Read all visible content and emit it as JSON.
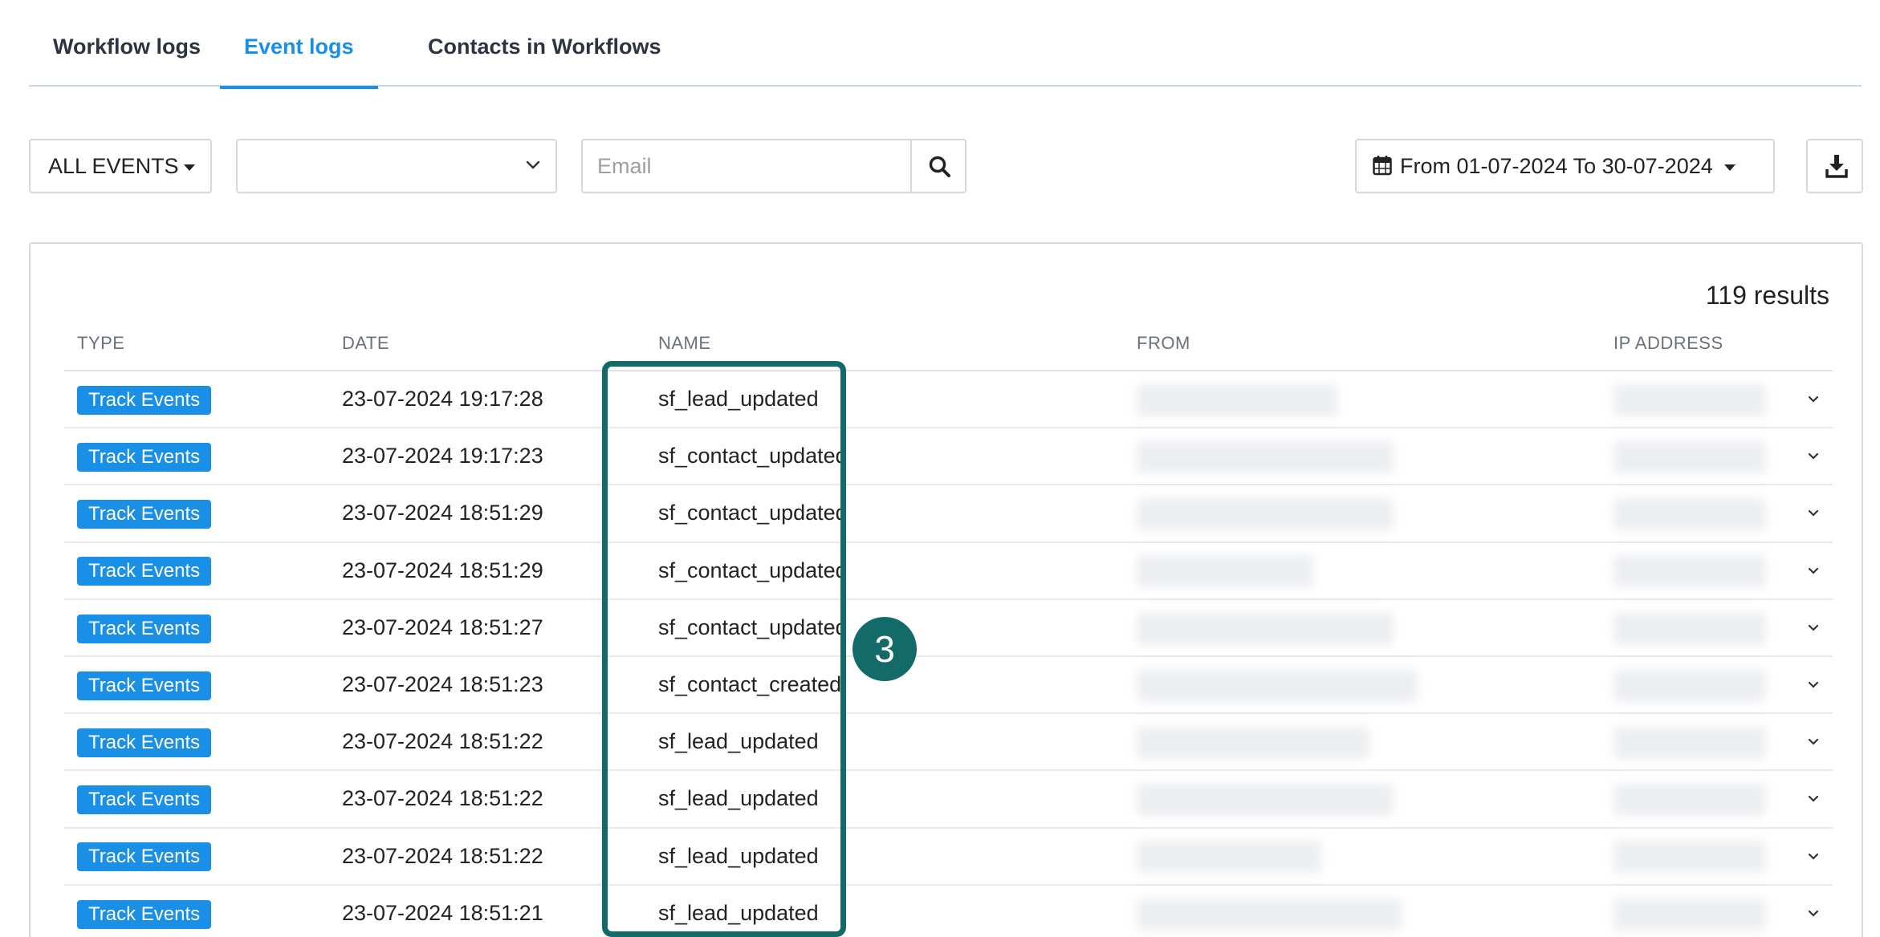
{
  "tabs": [
    {
      "label": "Workflow logs",
      "active": false
    },
    {
      "label": "Event logs",
      "active": true
    },
    {
      "label": "Contacts in Workflows",
      "active": false
    }
  ],
  "toolbar": {
    "events_filter": "ALL EVENTS",
    "email_placeholder": "Email",
    "date_range": "From 01-07-2024 To 30-07-2024"
  },
  "results_label": "119 results",
  "table": {
    "headers": {
      "type": "TYPE",
      "date": "DATE",
      "name": "NAME",
      "from": "FROM",
      "ip": "IP ADDRESS"
    },
    "rows": [
      {
        "type": "Track Events",
        "date": "23-07-2024 19:17:28",
        "name": "sf_lead_updated"
      },
      {
        "type": "Track Events",
        "date": "23-07-2024 19:17:23",
        "name": "sf_contact_updated"
      },
      {
        "type": "Track Events",
        "date": "23-07-2024 18:51:29",
        "name": "sf_contact_updated"
      },
      {
        "type": "Track Events",
        "date": "23-07-2024 18:51:29",
        "name": "sf_contact_updated"
      },
      {
        "type": "Track Events",
        "date": "23-07-2024 18:51:27",
        "name": "sf_contact_updated"
      },
      {
        "type": "Track Events",
        "date": "23-07-2024 18:51:23",
        "name": "sf_contact_created"
      },
      {
        "type": "Track Events",
        "date": "23-07-2024 18:51:22",
        "name": "sf_lead_updated"
      },
      {
        "type": "Track Events",
        "date": "23-07-2024 18:51:22",
        "name": "sf_lead_updated"
      },
      {
        "type": "Track Events",
        "date": "23-07-2024 18:51:22",
        "name": "sf_lead_updated"
      },
      {
        "type": "Track Events",
        "date": "23-07-2024 18:51:21",
        "name": "sf_lead_updated"
      }
    ]
  },
  "annotation": {
    "number": "3",
    "color": "#126b68"
  },
  "colors": {
    "accent": "#1a8fe6",
    "badge": "#1a8fe6"
  },
  "icons": [
    "search-icon",
    "calendar-icon",
    "download-icon",
    "chevron-down-icon"
  ]
}
